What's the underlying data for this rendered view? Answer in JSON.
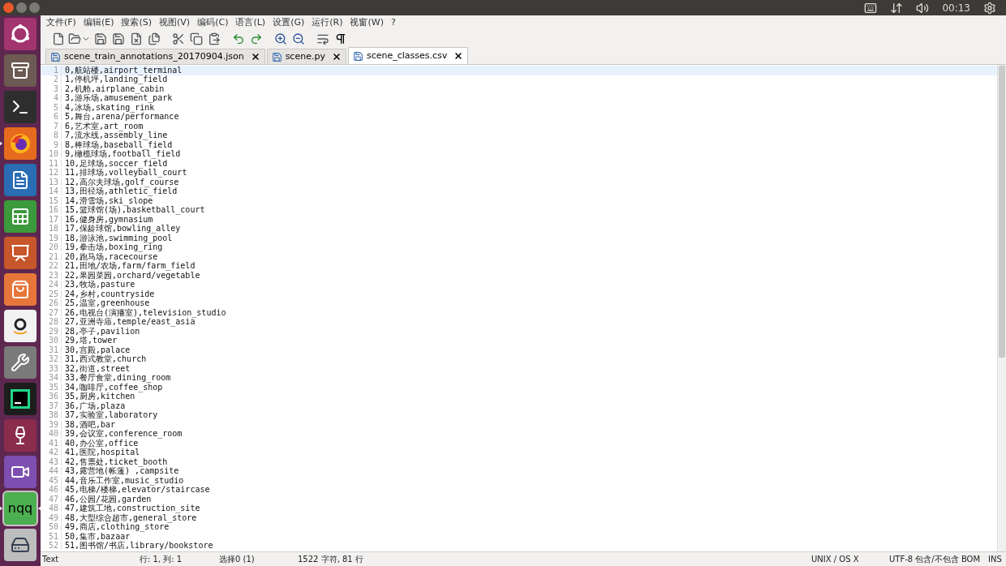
{
  "top_panel": {
    "clock": "00:13"
  },
  "launcher": [
    {
      "kind": "ubuntu",
      "running": false,
      "focused": false
    },
    {
      "kind": "files",
      "running": false,
      "focused": false
    },
    {
      "kind": "terminal",
      "running": false,
      "focused": false
    },
    {
      "kind": "firefox",
      "running": true,
      "focused": false
    },
    {
      "kind": "writer",
      "running": false,
      "focused": false
    },
    {
      "kind": "calc",
      "running": false,
      "focused": false
    },
    {
      "kind": "impress",
      "running": false,
      "focused": false
    },
    {
      "kind": "store",
      "running": false,
      "focused": false
    },
    {
      "kind": "amazon",
      "running": false,
      "focused": false
    },
    {
      "kind": "settings",
      "running": false,
      "focused": false
    },
    {
      "kind": "pycharm",
      "running": false,
      "focused": false
    },
    {
      "kind": "wine",
      "running": false,
      "focused": false
    },
    {
      "kind": "webcam",
      "running": false,
      "focused": false
    },
    {
      "kind": "nqq",
      "label": "nqq",
      "running": true,
      "focused": true
    },
    {
      "kind": "disks",
      "running": false,
      "focused": false
    }
  ],
  "menu": [
    "文件(F)",
    "编辑(E)",
    "搜索(S)",
    "视图(V)",
    "编码(C)",
    "语言(L)",
    "设置(G)",
    "运行(R)",
    "视窗(W)",
    "?"
  ],
  "tabs": [
    {
      "label": "scene_train_annotations_20170904.json",
      "selected": false
    },
    {
      "label": "scene.py",
      "selected": false
    },
    {
      "label": "scene_classes.csv",
      "selected": true
    }
  ],
  "lines": [
    {
      "number": "1",
      "text": "0,航站楼,airport_terminal",
      "current": true
    },
    {
      "number": "2",
      "text": "1,停机坪,landing_field",
      "current": false
    },
    {
      "number": "3",
      "text": "2,机舱,airplane_cabin",
      "current": false
    },
    {
      "number": "4",
      "text": "3,游乐场,amusement_park",
      "current": false
    },
    {
      "number": "5",
      "text": "4,冰场,skating_rink",
      "current": false
    },
    {
      "number": "6",
      "text": "5,舞台,arena/performance",
      "current": false
    },
    {
      "number": "7",
      "text": "6,艺术室,art_room",
      "current": false
    },
    {
      "number": "8",
      "text": "7,流水线,assembly_line",
      "current": false
    },
    {
      "number": "9",
      "text": "8,棒球场,baseball_field",
      "current": false
    },
    {
      "number": "10",
      "text": "9,橄榄球场,football_field",
      "current": false
    },
    {
      "number": "11",
      "text": "10,足球场,soccer_field",
      "current": false
    },
    {
      "number": "12",
      "text": "11,排球场,volleyball_court",
      "current": false
    },
    {
      "number": "13",
      "text": "12,高尔夫球场,golf_course",
      "current": false
    },
    {
      "number": "14",
      "text": "13,田径场,athletic_field",
      "current": false
    },
    {
      "number": "15",
      "text": "14,滑雪场,ski_slope",
      "current": false
    },
    {
      "number": "16",
      "text": "15,篮球馆(场),basketball_court",
      "current": false
    },
    {
      "number": "17",
      "text": "16,健身房,gymnasium",
      "current": false
    },
    {
      "number": "18",
      "text": "17,保龄球馆,bowling_alley",
      "current": false
    },
    {
      "number": "19",
      "text": "18,游泳池,swimming_pool",
      "current": false
    },
    {
      "number": "20",
      "text": "19,拳击场,boxing_ring",
      "current": false
    },
    {
      "number": "21",
      "text": "20,跑马场,racecourse",
      "current": false
    },
    {
      "number": "22",
      "text": "21,田地/农场,farm/farm_field",
      "current": false
    },
    {
      "number": "23",
      "text": "22,果园菜园,orchard/vegetable",
      "current": false
    },
    {
      "number": "24",
      "text": "23,牧场,pasture",
      "current": false
    },
    {
      "number": "25",
      "text": "24,乡村,countryside",
      "current": false
    },
    {
      "number": "26",
      "text": "25,温室,greenhouse",
      "current": false
    },
    {
      "number": "27",
      "text": "26,电视台(演播室),television_studio",
      "current": false
    },
    {
      "number": "28",
      "text": "27,亚洲寺庙,temple/east_asia",
      "current": false
    },
    {
      "number": "29",
      "text": "28,亭子,pavilion",
      "current": false
    },
    {
      "number": "30",
      "text": "29,塔,tower",
      "current": false
    },
    {
      "number": "31",
      "text": "30,宫殿,palace",
      "current": false
    },
    {
      "number": "32",
      "text": "31,西式教堂,church",
      "current": false
    },
    {
      "number": "33",
      "text": "32,街道,street",
      "current": false
    },
    {
      "number": "34",
      "text": "33,餐厅食堂,dining_room",
      "current": false
    },
    {
      "number": "35",
      "text": "34,咖啡厅,coffee_shop",
      "current": false
    },
    {
      "number": "36",
      "text": "35,厨房,kitchen",
      "current": false
    },
    {
      "number": "37",
      "text": "36,广场,plaza",
      "current": false
    },
    {
      "number": "38",
      "text": "37,实验室,laboratory",
      "current": false
    },
    {
      "number": "39",
      "text": "38,酒吧,bar",
      "current": false
    },
    {
      "number": "40",
      "text": "39,会议室,conference_room",
      "current": false
    },
    {
      "number": "41",
      "text": "40,办公室,office",
      "current": false
    },
    {
      "number": "42",
      "text": "41,医院,hospital",
      "current": false
    },
    {
      "number": "43",
      "text": "42,售票处,ticket_booth",
      "current": false
    },
    {
      "number": "44",
      "text": "43,露营地(帐篷) ,campsite",
      "current": false
    },
    {
      "number": "45",
      "text": "44,音乐工作室,music_studio",
      "current": false
    },
    {
      "number": "46",
      "text": "45,电梯/楼梯,elevator/staircase",
      "current": false
    },
    {
      "number": "47",
      "text": "46,公园/花园,garden",
      "current": false
    },
    {
      "number": "48",
      "text": "47,建筑工地,construction_site",
      "current": false
    },
    {
      "number": "49",
      "text": "48,大型综合超市,general_store",
      "current": false
    },
    {
      "number": "50",
      "text": "49,商店,clothing_store",
      "current": false
    },
    {
      "number": "51",
      "text": "50,集市,bazaar",
      "current": false
    },
    {
      "number": "52",
      "text": "51,图书馆/书店,library/bookstore",
      "current": false
    }
  ],
  "status_bar": {
    "language": "Text",
    "position": "行: 1, 列: 1",
    "selection": "选择0 (1)",
    "counts": "1522 字符, 81 行",
    "eol": "UNIX / OS X",
    "encoding": "UTF-8 包含/不包含 BOM",
    "mode": "INS"
  }
}
